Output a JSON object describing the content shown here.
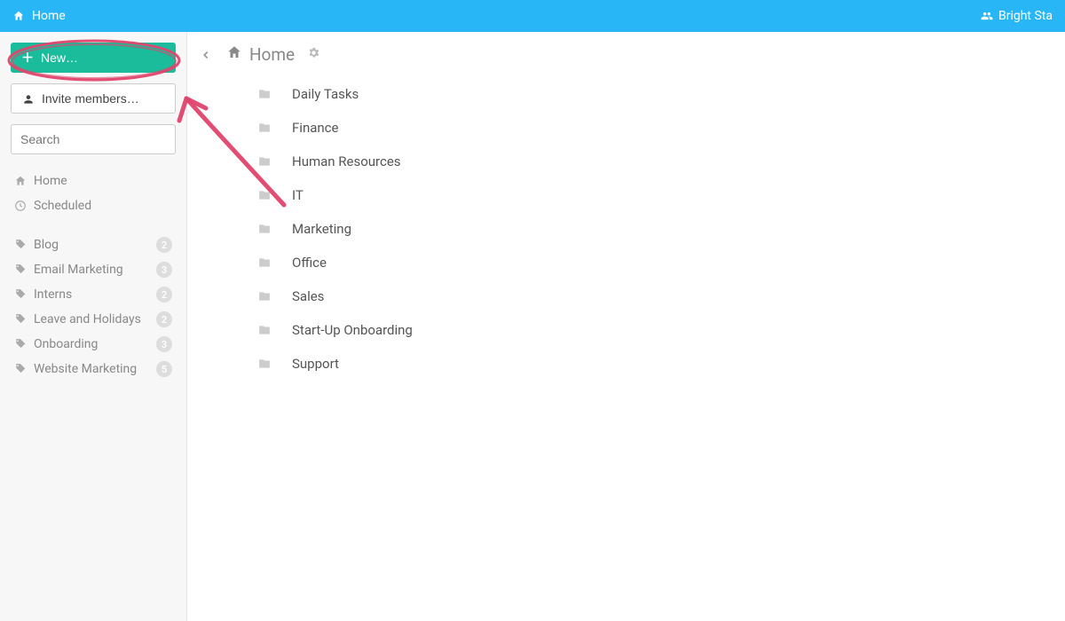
{
  "topbar": {
    "home_label": "Home",
    "org_label": "Bright Sta"
  },
  "sidebar": {
    "new_label": "New…",
    "invite_label": "Invite members…",
    "search_placeholder": "Search",
    "nav": {
      "home": "Home",
      "scheduled": "Scheduled"
    },
    "tags": [
      {
        "label": "Blog",
        "count": 2
      },
      {
        "label": "Email Marketing",
        "count": 3
      },
      {
        "label": "Interns",
        "count": 2
      },
      {
        "label": "Leave and Holidays",
        "count": 2
      },
      {
        "label": "Onboarding",
        "count": 3
      },
      {
        "label": "Website Marketing",
        "count": 5
      }
    ]
  },
  "main": {
    "breadcrumb": "Home",
    "folders": [
      "Daily Tasks",
      "Finance",
      "Human Resources",
      "IT",
      "Marketing",
      "Office",
      "Sales",
      "Start-Up Onboarding",
      "Support"
    ]
  }
}
